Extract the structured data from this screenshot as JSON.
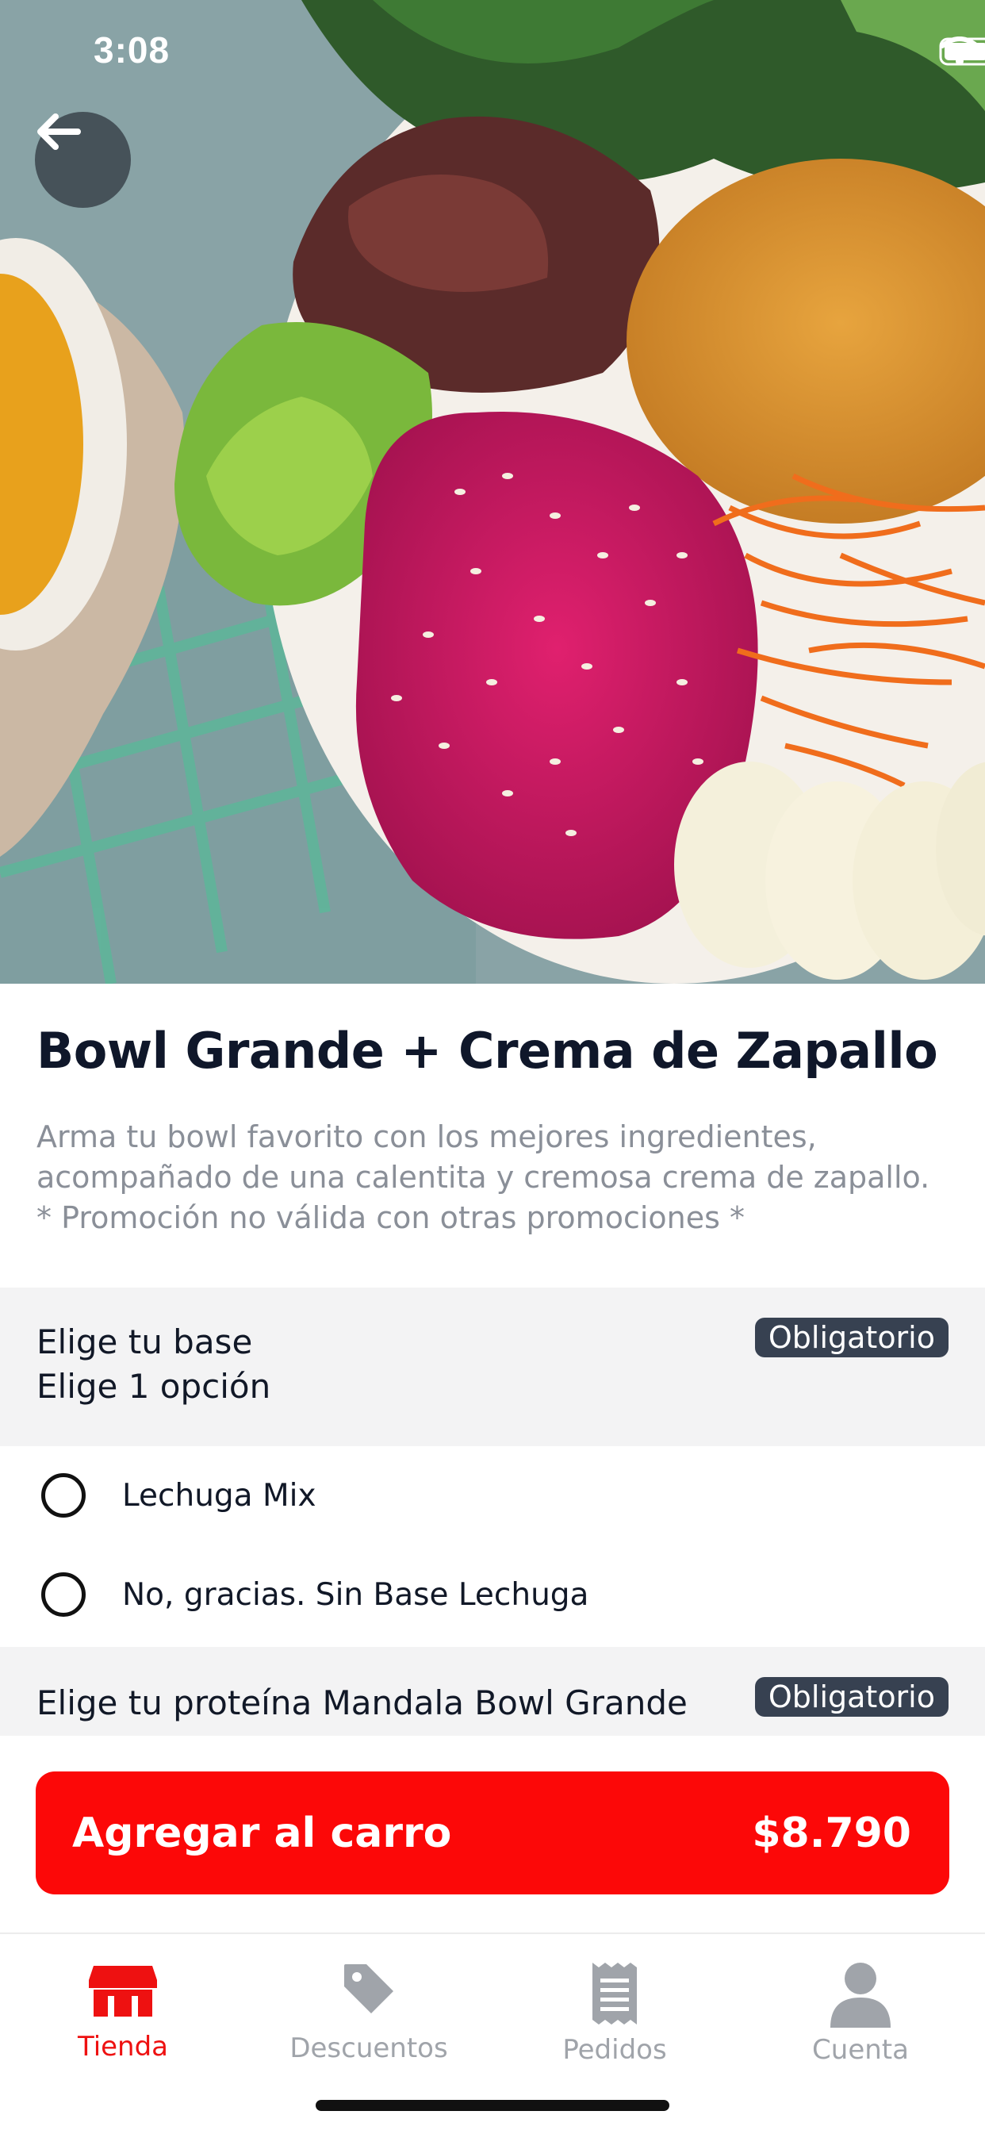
{
  "status_bar": {
    "time": "3:08"
  },
  "product": {
    "title": "Bowl Grande + Crema de Zapallo",
    "description_lines": [
      "Arma tu bowl favorito con los mejores ingredientes,",
      "acompañado de una calentita y cremosa crema de zapallo.",
      "* Promoción no válida con otras promociones *"
    ]
  },
  "sections": [
    {
      "title": "Elige tu base",
      "subtitle": "Elige 1 opción",
      "badge": "Obligatorio",
      "options": [
        {
          "label": "Lechuga Mix",
          "selected": false
        },
        {
          "label": "No, gracias. Sin Base Lechuga",
          "selected": false
        }
      ]
    },
    {
      "title": "Elige tu proteína Mandala Bowl Grande",
      "badge": "Obligatorio"
    }
  ],
  "cta": {
    "label": "Agregar al carro",
    "price": "$8.790"
  },
  "bottom_nav": [
    {
      "label": "Tienda",
      "icon": "store-icon",
      "active": true
    },
    {
      "label": "Descuentos",
      "icon": "tag-icon",
      "active": false
    },
    {
      "label": "Pedidos",
      "icon": "receipt-icon",
      "active": false
    },
    {
      "label": "Cuenta",
      "icon": "user-icon",
      "active": false
    }
  ],
  "colors": {
    "accent": "#fc0808",
    "badge_bg": "#374151",
    "section_bg": "#f3f3f4",
    "inactive": "#a0a4aa"
  }
}
